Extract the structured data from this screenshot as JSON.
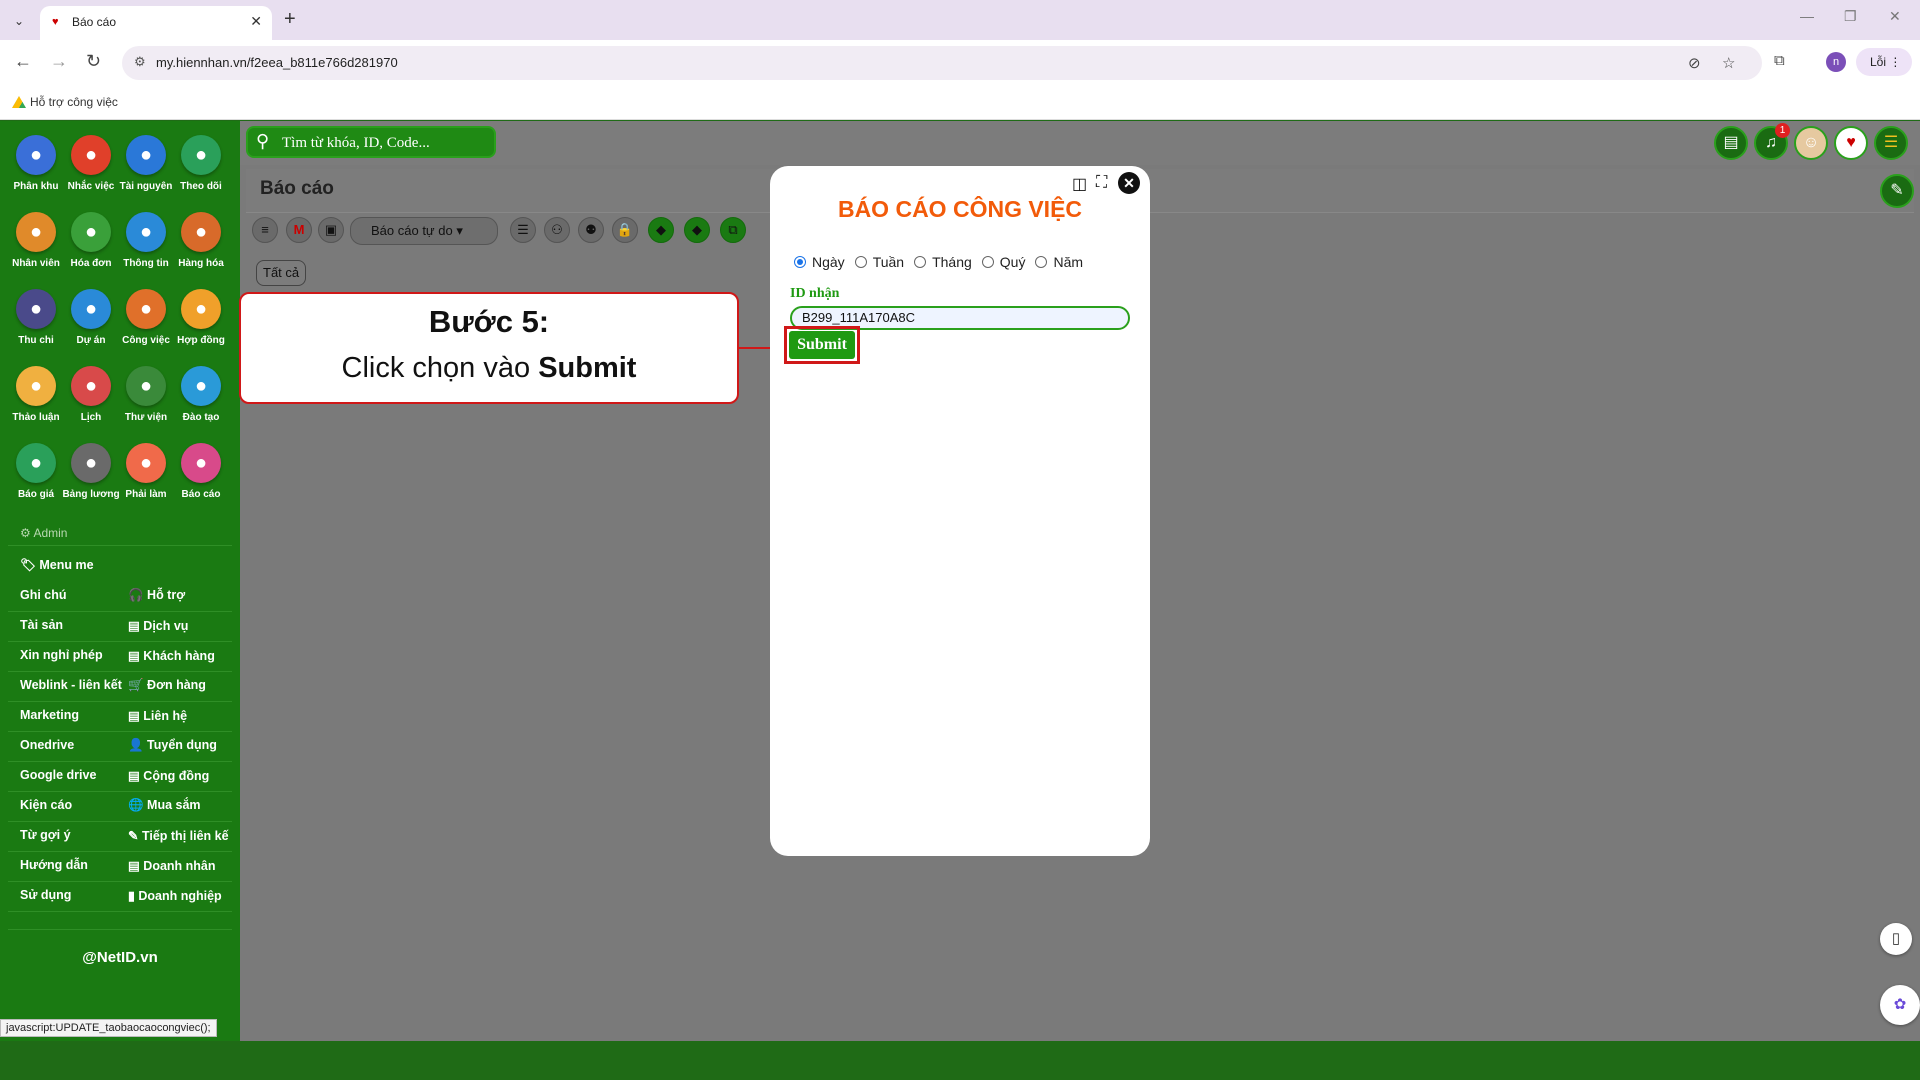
{
  "browser": {
    "tab_title": "Báo cáo",
    "url": "my.hiennhan.vn/f2eea_b811e766d281970",
    "bookmark": "Hỗ trợ công việc",
    "profile_initial": "n",
    "error_pill": "Lỗi"
  },
  "search": {
    "placeholder": "Tìm từ khóa, ID, Code..."
  },
  "notifications": {
    "count": "1"
  },
  "page": {
    "title": "Báo cáo",
    "dropdown": "Báo cáo tự do",
    "filter": "Tất cả"
  },
  "sidebar": {
    "icons": [
      {
        "label": "Phân khu",
        "icon": "building-icon",
        "color": "#3a6fd8"
      },
      {
        "label": "Nhắc việc",
        "icon": "clock-icon",
        "color": "#e0402a"
      },
      {
        "label": "Tài nguyên",
        "icon": "media-icon",
        "color": "#2a78d8"
      },
      {
        "label": "Theo dõi",
        "icon": "network-icon",
        "color": "#2aa05a"
      },
      {
        "label": "Nhân viên",
        "icon": "people-icon",
        "color": "#e08a2a"
      },
      {
        "label": "Hóa đơn",
        "icon": "scissors-icon",
        "color": "#3aa03a"
      },
      {
        "label": "Thông tin",
        "icon": "info-icon",
        "color": "#2a8ad8"
      },
      {
        "label": "Hàng hóa",
        "icon": "boxes-icon",
        "color": "#d86a2a"
      },
      {
        "label": "Thu chi",
        "icon": "money-icon",
        "color": "#4a4a8a"
      },
      {
        "label": "Dự án",
        "icon": "brain-icon",
        "color": "#2a8ad8"
      },
      {
        "label": "Công việc",
        "icon": "briefcase-icon",
        "color": "#e0702a"
      },
      {
        "label": "Hợp đồng",
        "icon": "pen-icon",
        "color": "#f0a02a"
      },
      {
        "label": "Thảo luận",
        "icon": "chat-icon",
        "color": "#f0b040"
      },
      {
        "label": "Lịch",
        "icon": "calendar-icon",
        "color": "#d84a4a"
      },
      {
        "label": "Thư viện",
        "icon": "books-icon",
        "color": "#3a8a3a"
      },
      {
        "label": "Đào tạo",
        "icon": "training-icon",
        "color": "#2a9ad8"
      },
      {
        "label": "Báo giá",
        "icon": "tag-icon",
        "color": "#2aa05a"
      },
      {
        "label": "Bảng lương",
        "icon": "salary-icon",
        "color": "#6a6a6a"
      },
      {
        "label": "Phải làm",
        "icon": "checklist-icon",
        "color": "#f06a4a"
      },
      {
        "label": "Báo cáo",
        "icon": "report-icon",
        "color": "#d84a8a"
      }
    ],
    "admin": "Admin",
    "menu_me": "Menu me",
    "left_items": [
      "Ghi chú",
      "Tài sản",
      "Xin nghỉ phép",
      "Weblink - liên kết",
      "Marketing",
      "Onedrive",
      "Google drive",
      "Kiện cáo",
      "Từ gợi ý",
      "Hướng dẫn",
      "Sử dụng"
    ],
    "right_items": [
      "Hỗ trợ",
      "Dịch vụ",
      "Khách hàng",
      "Đơn hàng",
      "Liên hệ",
      "Tuyển dụng",
      "Cộng đồng",
      "Mua sắm",
      "Tiếp thị liên kế",
      "Doanh nhân",
      "Doanh nghiệp"
    ],
    "footer": "@NetID.vn"
  },
  "statusbar": "javascript:UPDATE_taobaocaocongviec();",
  "modal": {
    "title": "BÁO CÁO CÔNG VIỆC",
    "periods": [
      "Ngày",
      "Tuần",
      "Tháng",
      "Quý",
      "Năm"
    ],
    "selected_period": "Ngày",
    "id_label": "ID nhận",
    "id_value": "B299_111A170A8C",
    "submit": "Submit"
  },
  "callout": {
    "step": "Bước 5:",
    "text_prefix": "Click chọn vào ",
    "text_bold": "Submit"
  },
  "colors": {
    "app_green": "#1a7a12",
    "overlay_gray": "#7a7a7a",
    "modal_title": "#f25b0a",
    "highlight_red": "#d01818"
  }
}
